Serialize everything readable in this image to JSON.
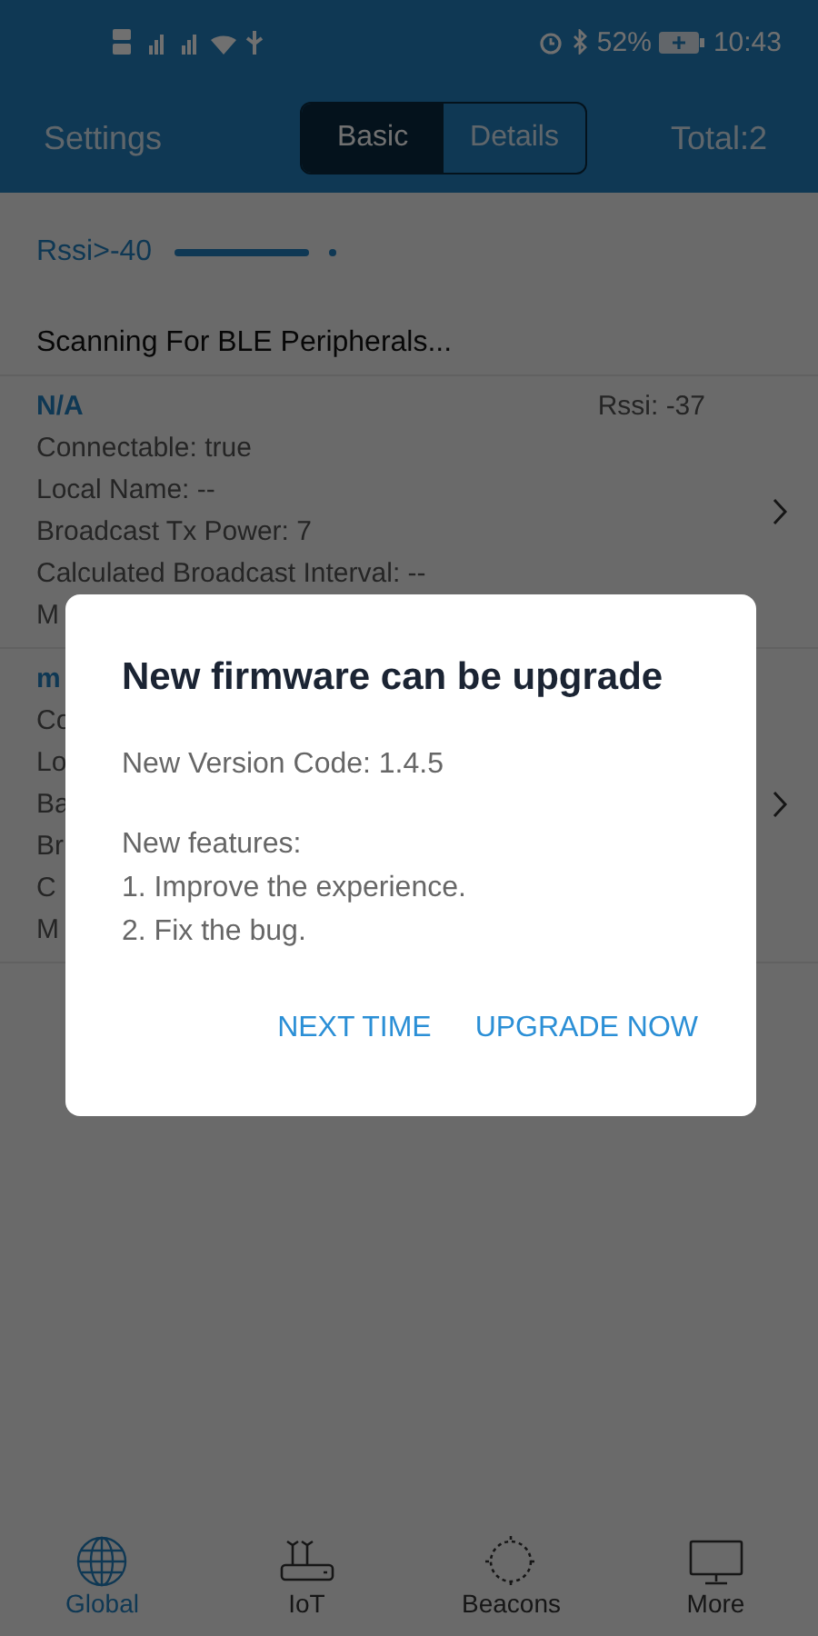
{
  "status_bar": {
    "battery": "52%",
    "time": "10:43"
  },
  "header": {
    "left": "Settings",
    "tabs": [
      {
        "label": "Basic",
        "selected": true
      },
      {
        "label": "Details",
        "selected": false
      }
    ],
    "total": "Total:2"
  },
  "filter": {
    "label": "Rssi>-40",
    "level": 0.88
  },
  "scan_title": "Scanning For BLE Peripherals...",
  "devices": [
    {
      "name": "N/A",
      "rssi": "Rssi: -37",
      "lines": [
        "Connectable: true",
        "Local Name: --",
        "Broadcast Tx Power: 7",
        "Calculated Broadcast Interval: --",
        "M"
      ]
    },
    {
      "name": "m",
      "lines": [
        "Co",
        "Lo",
        "Ba",
        "Br",
        "C",
        "M"
      ]
    }
  ],
  "dialog": {
    "title": "New firmware can be upgrade",
    "version": "New Version Code: 1.4.5",
    "features_title": "New features:",
    "features": [
      "1. Improve the experience.",
      "2. Fix the bug."
    ],
    "buttons": [
      "NEXT TIME",
      "UPGRADE NOW"
    ]
  },
  "nav": [
    {
      "label": "Global",
      "kind": "globe",
      "selected": true
    },
    {
      "label": "IoT",
      "kind": "router",
      "selected": false
    },
    {
      "label": "Beacons",
      "kind": "beacon",
      "selected": false
    },
    {
      "label": "More",
      "kind": "monitor",
      "selected": false
    }
  ]
}
